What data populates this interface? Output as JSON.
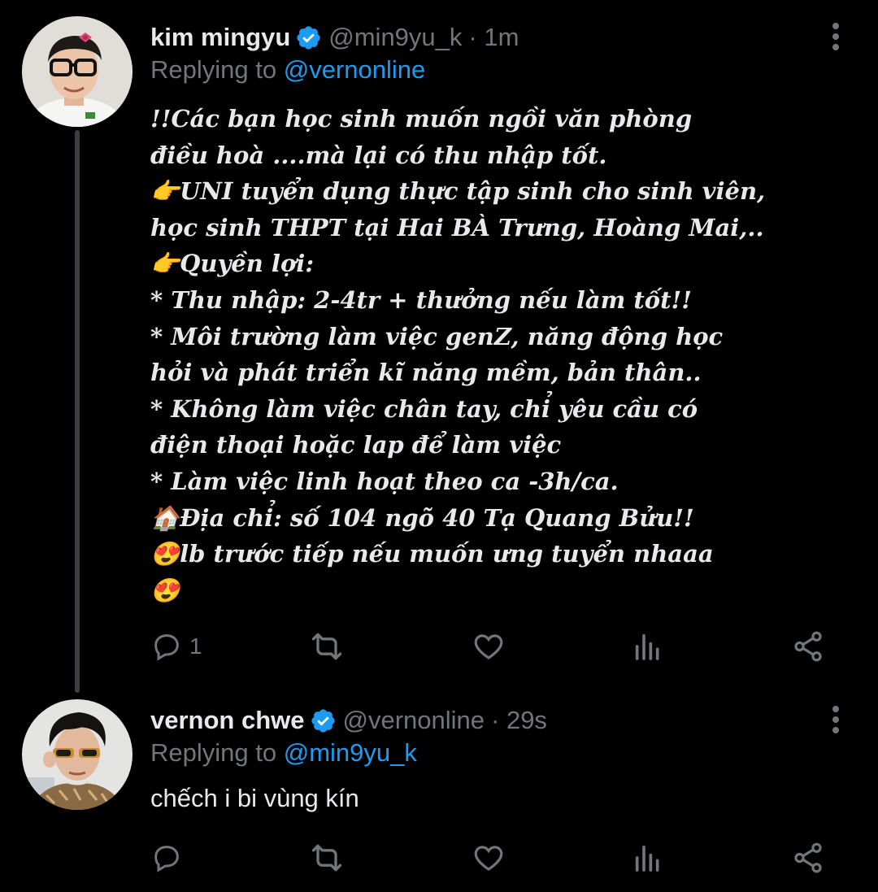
{
  "tweets": [
    {
      "name": "kim mingyu",
      "handle": "@min9yu_k",
      "time": "· 1m",
      "replying_label": "Replying to",
      "replying_to": "@vernonline",
      "body_lines": [
        "!!Các bạn học sinh muốn ngồi văn phòng",
        "điều hoà ....mà lại có thu nhập tốt.",
        "👉UNI tuyển dụng thực tập sinh cho sinh viên,",
        "học sinh THPT tại Hai BÀ Trưng, Hoàng Mai,..",
        "👉Quyền lợi:",
        "* Thu nhập: 2-4tr + thưởng nếu làm tốt!!",
        "* Môi trường làm việc genZ, năng động học",
        "hỏi và phát triển kĩ năng mềm, bản thân..",
        "* Không làm việc chân tay, chỉ yêu cầu có",
        "điện thoại hoặc lap để làm việc",
        "* Làm việc linh hoạt theo ca -3h/ca.",
        "🏠Địa chỉ: số 104 ngõ 40 Tạ Quang Bửu!!",
        "😍lb trước tiếp nếu muốn ưng tuyển nhaaa",
        "😍"
      ],
      "reply_count": "1",
      "icons": [
        "verified-badge-icon",
        "more-icon",
        "reply-icon",
        "retweet-icon",
        "like-icon",
        "views-icon",
        "share-icon"
      ]
    },
    {
      "name": "vernon chwe",
      "handle": "@vernonline",
      "time": "· 29s",
      "replying_label": "Replying to",
      "replying_to": "@min9yu_k",
      "body": "chếch i bi vùng kín",
      "reply_count": "",
      "icons": [
        "verified-badge-icon",
        "more-icon",
        "reply-icon",
        "retweet-icon",
        "like-icon",
        "views-icon",
        "share-icon"
      ]
    }
  ],
  "colors": {
    "background": "#000000",
    "text": "#e7e9ea",
    "muted": "#71767b",
    "accent": "#1d9bf0",
    "thread_line": "#3b3f44"
  }
}
